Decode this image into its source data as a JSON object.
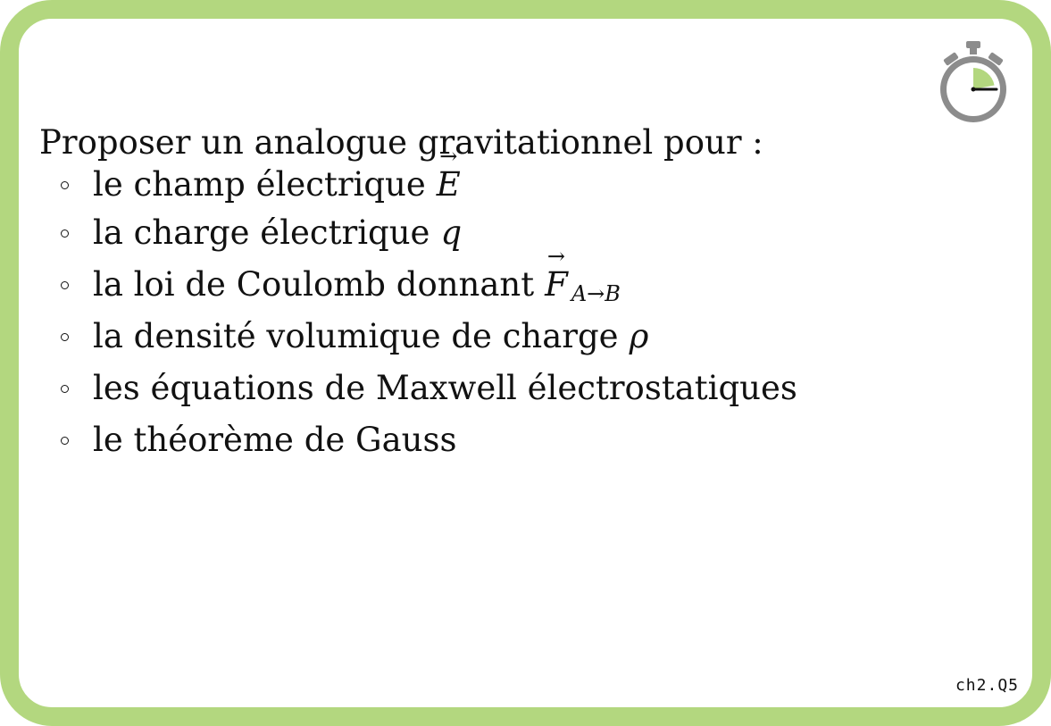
{
  "colors": {
    "frame": "#b3d77f",
    "timer_fill": "#b3d77f",
    "timer_ring": "#8c8c8c"
  },
  "timer": {
    "icon": "stopwatch-icon",
    "elapsed_fraction": 0.22
  },
  "card": {
    "prompt": "Proposer un analogue gravitationnel pour :",
    "items": [
      {
        "text": "le champ électrique",
        "math": "E",
        "vector": true,
        "sub": ""
      },
      {
        "text": "la charge électrique",
        "math": "q",
        "vector": false,
        "sub": ""
      },
      {
        "text": "la loi de Coulomb donnant",
        "math": "F",
        "vector": true,
        "sub": "A→B"
      },
      {
        "text": "la densité volumique de charge",
        "math": "ρ",
        "vector": false,
        "sub": ""
      },
      {
        "text": "les équations de Maxwell électrostatiques",
        "math": "",
        "vector": false,
        "sub": ""
      },
      {
        "text": "le théorème de Gauss",
        "math": "",
        "vector": false,
        "sub": ""
      }
    ],
    "tag": "ch2.Q5"
  }
}
